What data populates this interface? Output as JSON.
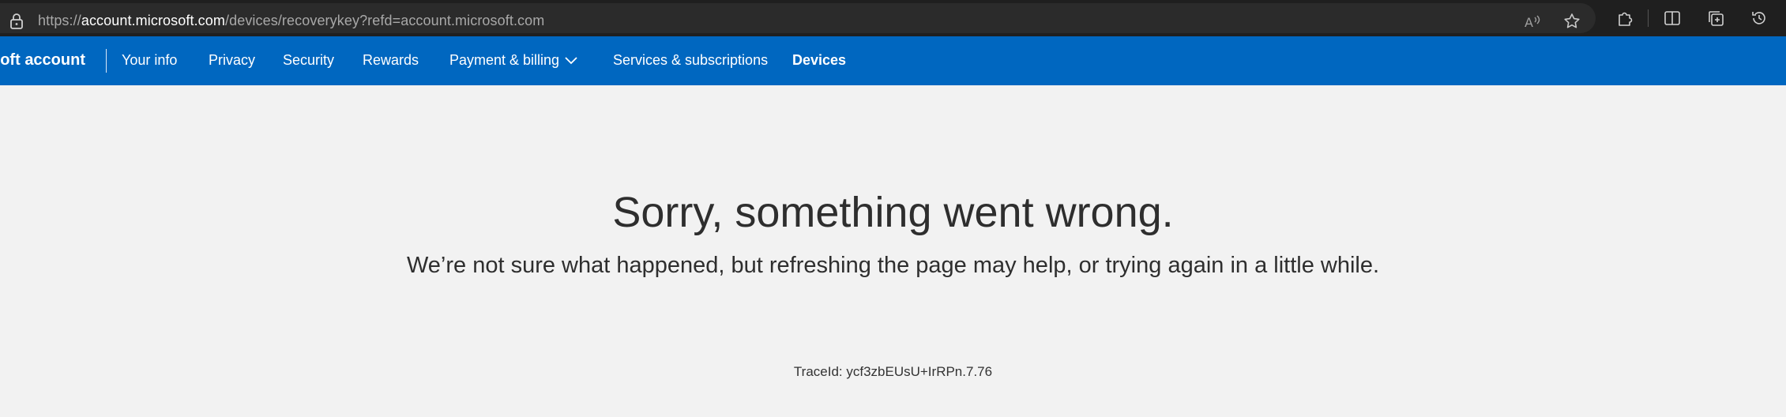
{
  "browser": {
    "url_prefix": "https://",
    "url_domain": "account.microsoft.com",
    "url_path": "/devices/recoverykey?refd=account.microsoft.com",
    "icons": [
      "lock-icon",
      "read-aloud-icon",
      "favorite-star-icon",
      "extensions-icon",
      "split-screen-icon",
      "collections-icon",
      "history-icon"
    ]
  },
  "nav": {
    "brand": "oft account",
    "items": [
      {
        "label": "Your info"
      },
      {
        "label": "Privacy"
      },
      {
        "label": "Security"
      },
      {
        "label": "Rewards"
      },
      {
        "label": "Payment & billing"
      },
      {
        "label": "Services & subscriptions"
      },
      {
        "label": "Devices"
      }
    ],
    "color": "#0067c0"
  },
  "error": {
    "title": "Sorry, something went wrong.",
    "message": "We’re not sure what happened, but refreshing the page may help, or trying again in a little while.",
    "trace": "TraceId: ycf3zbEUsU+IrRPn.7.76"
  }
}
